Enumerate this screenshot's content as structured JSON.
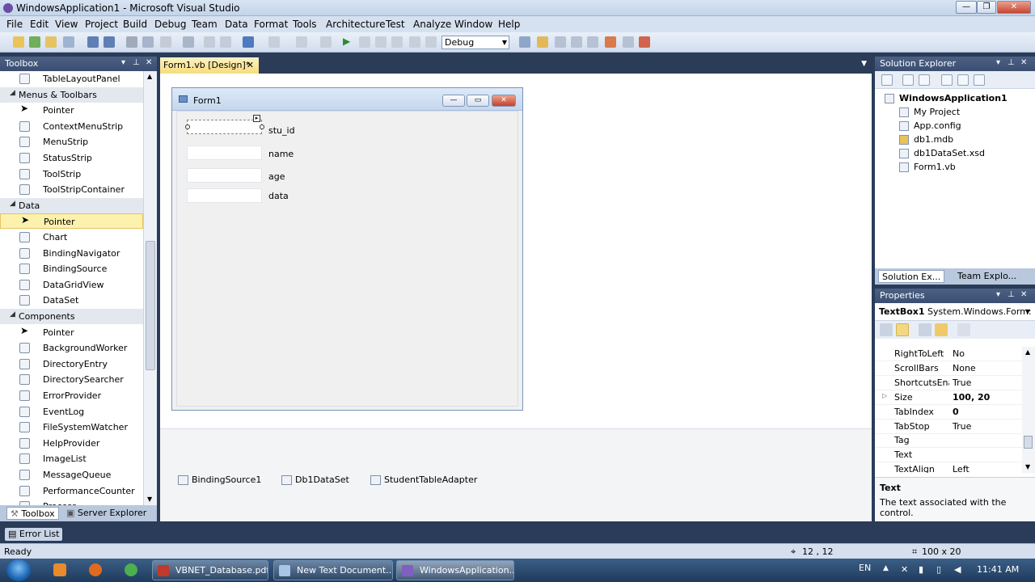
{
  "window": {
    "title": "WindowsApplication1 - Microsoft Visual Studio"
  },
  "menu": [
    "File",
    "Edit",
    "View",
    "Project",
    "Build",
    "Debug",
    "Team",
    "Data",
    "Format",
    "Tools",
    "Architecture",
    "Test",
    "Analyze",
    "Window",
    "Help"
  ],
  "toolbar": {
    "configuration": "Debug"
  },
  "toolbox": {
    "title": "Toolbox",
    "items": [
      {
        "label": "TableLayoutPanel",
        "kind": "item"
      },
      {
        "label": "Menus & Toolbars",
        "kind": "category"
      },
      {
        "label": "Pointer",
        "kind": "pointer"
      },
      {
        "label": "ContextMenuStrip",
        "kind": "item"
      },
      {
        "label": "MenuStrip",
        "kind": "item"
      },
      {
        "label": "StatusStrip",
        "kind": "item"
      },
      {
        "label": "ToolStrip",
        "kind": "item"
      },
      {
        "label": "ToolStripContainer",
        "kind": "item"
      },
      {
        "label": "Data",
        "kind": "category"
      },
      {
        "label": "Pointer",
        "kind": "pointer",
        "selected": true
      },
      {
        "label": "Chart",
        "kind": "item"
      },
      {
        "label": "BindingNavigator",
        "kind": "item"
      },
      {
        "label": "BindingSource",
        "kind": "item"
      },
      {
        "label": "DataGridView",
        "kind": "item"
      },
      {
        "label": "DataSet",
        "kind": "item"
      },
      {
        "label": "Components",
        "kind": "category"
      },
      {
        "label": "Pointer",
        "kind": "pointer"
      },
      {
        "label": "BackgroundWorker",
        "kind": "item"
      },
      {
        "label": "DirectoryEntry",
        "kind": "item"
      },
      {
        "label": "DirectorySearcher",
        "kind": "item"
      },
      {
        "label": "ErrorProvider",
        "kind": "item"
      },
      {
        "label": "EventLog",
        "kind": "item"
      },
      {
        "label": "FileSystemWatcher",
        "kind": "item"
      },
      {
        "label": "HelpProvider",
        "kind": "item"
      },
      {
        "label": "ImageList",
        "kind": "item"
      },
      {
        "label": "MessageQueue",
        "kind": "item"
      },
      {
        "label": "PerformanceCounter",
        "kind": "item"
      },
      {
        "label": "Process",
        "kind": "item"
      }
    ],
    "tabs": [
      "Toolbox",
      "Server Explorer"
    ]
  },
  "document": {
    "tab_label": "Form1.vb [Design]*",
    "form": {
      "title": "Form1",
      "labels": [
        "stu_id",
        "name",
        "age",
        "data"
      ]
    },
    "tray_components": [
      "BindingSource1",
      "Db1DataSet",
      "StudentTableAdapter"
    ]
  },
  "solution_explorer": {
    "title": "Solution Explorer",
    "root": "WindowsApplication1",
    "items": [
      "My Project",
      "App.config",
      "db1.mdb",
      "db1DataSet.xsd",
      "Form1.vb"
    ],
    "tabs": [
      "Solution Ex...",
      "Team Explo..."
    ]
  },
  "properties": {
    "title": "Properties",
    "object_name": "TextBox1",
    "object_type": "System.Windows.Form:",
    "rows": [
      {
        "name": "RightToLeft",
        "value": "No"
      },
      {
        "name": "ScrollBars",
        "value": "None"
      },
      {
        "name": "ShortcutsEnal",
        "value": "True"
      },
      {
        "name": "Size",
        "value": "100, 20",
        "bold": true,
        "expandable": true
      },
      {
        "name": "TabIndex",
        "value": "0",
        "bold": true
      },
      {
        "name": "TabStop",
        "value": "True"
      },
      {
        "name": "Tag",
        "value": ""
      },
      {
        "name": "Text",
        "value": ""
      },
      {
        "name": "TextAlign",
        "value": "Left"
      }
    ],
    "description_title": "Text",
    "description_text": "The text associated with the control."
  },
  "error_list": {
    "label": "Error List"
  },
  "status": {
    "ready": "Ready",
    "position": "12 , 12",
    "size": "100 x 20"
  },
  "taskbar": {
    "tasks": [
      "VBNET_Database.pdf...",
      "New Text Document....",
      "WindowsApplication..."
    ],
    "language": "EN",
    "clock": "11:41 AM"
  },
  "colors": {
    "accent": "#2b3c59",
    "selection": "#fcf1ad",
    "doc_tab": "#f7dc7c"
  }
}
